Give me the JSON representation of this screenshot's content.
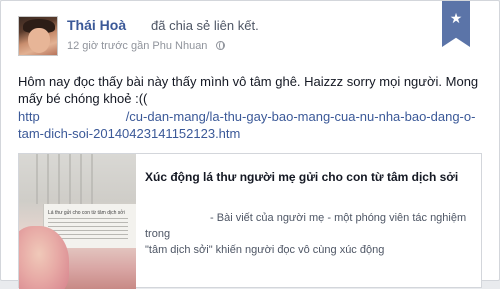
{
  "post": {
    "author": "Thái Hoà",
    "shared_text": "đã chia sẻ liên kết.",
    "time_location": "12 giờ trước gần Phu Nhuan",
    "privacy_icon": "globe-icon",
    "bookmark_icon": "star-icon",
    "bookmark_star": "★",
    "body": "Hôm nay đọc thấy bài này thấy mình vô tâm ghê. Haizzz sorry mọi người. Mong mấy bé chóng khoẻ :((",
    "link_prefix": "http",
    "link_part1": "/cu-dan-mang/la-thu-gay-bao-mang-cua-nu-nha-bao-dang-o-",
    "link_part2": "tam-dich-soi-20140423141152123.htm"
  },
  "attachment": {
    "title": "Xúc động lá thư người mẹ gửi cho con từ tâm dịch sởi",
    "desc_part1": " - Bài viết của người mẹ - một phóng viên tác nghiệm trong",
    "desc_part2": "\"tâm dịch sởi\" khiến người đọc vô cùng xúc động",
    "thumb_caption": "Lá thư gửi cho con từ tâm dịch sởi"
  },
  "colors": {
    "link": "#3b5998",
    "ribbon": "#5b74a8",
    "text": "#141823",
    "muted": "#90949c"
  }
}
